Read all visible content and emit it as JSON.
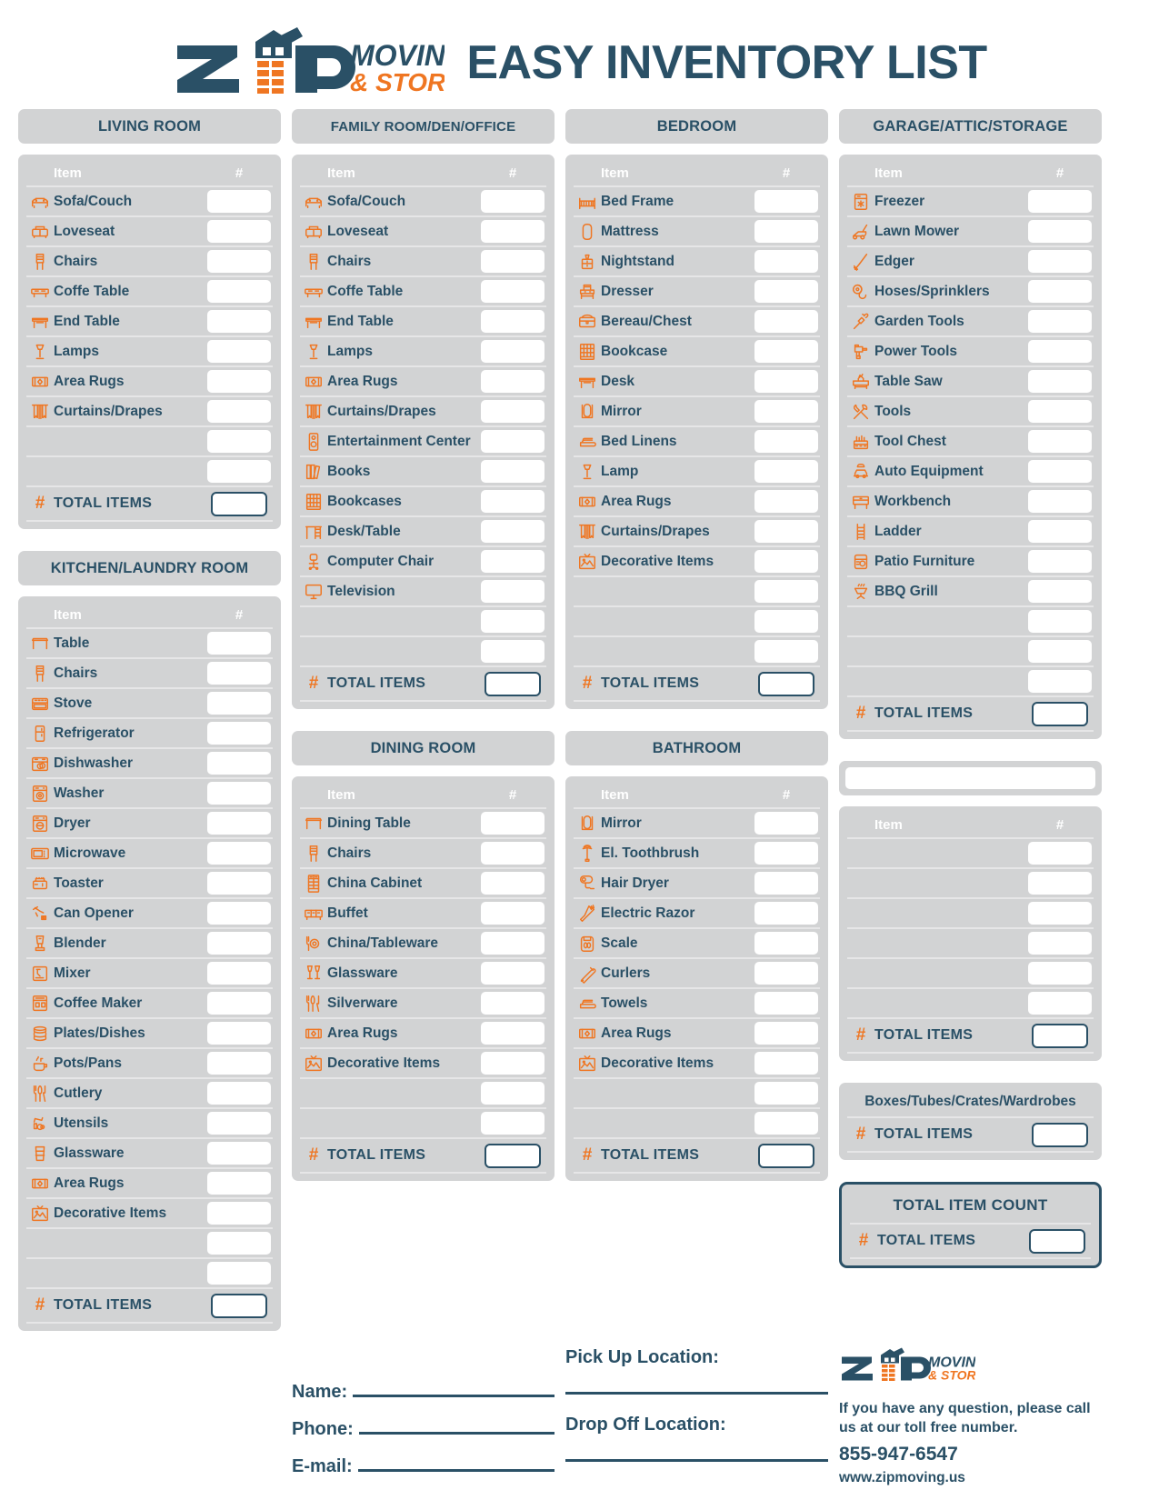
{
  "header": {
    "brand_name": "ZIP MOVING & STORAGE",
    "brand_line1": "MOVING",
    "brand_line2": "& STORAGE",
    "title": "EASY INVENTORY LIST"
  },
  "labels": {
    "item": "Item",
    "num": "#",
    "hash": "#",
    "total_items": "TOTAL ITEMS"
  },
  "colors": {
    "navy": "#2a5066",
    "orange": "#ef7622",
    "panel_gray": "#d2d3d4",
    "divider": "#e6e6e7",
    "white": "#ffffff"
  },
  "sections": [
    {
      "id": "living-room",
      "title": "LIVING ROOM",
      "items": [
        {
          "label": "Sofa/Couch",
          "icon": "sofa-icon"
        },
        {
          "label": "Loveseat",
          "icon": "loveseat-icon"
        },
        {
          "label": "Chairs",
          "icon": "chair-icon"
        },
        {
          "label": "Coffe Table",
          "icon": "coffee-table-icon"
        },
        {
          "label": "End Table",
          "icon": "end-table-icon"
        },
        {
          "label": "Lamps",
          "icon": "lamp-icon"
        },
        {
          "label": "Area Rugs",
          "icon": "rug-icon"
        },
        {
          "label": "Curtains/Drapes",
          "icon": "curtains-icon"
        }
      ],
      "blank_rows": 2
    },
    {
      "id": "kitchen-laundry-room",
      "title": "KITCHEN/LAUNDRY ROOM",
      "items": [
        {
          "label": "Table",
          "icon": "table-icon"
        },
        {
          "label": "Chairs",
          "icon": "chair-icon"
        },
        {
          "label": "Stove",
          "icon": "stove-icon"
        },
        {
          "label": "Refrigerator",
          "icon": "refrigerator-icon"
        },
        {
          "label": "Dishwasher",
          "icon": "dishwasher-icon"
        },
        {
          "label": "Washer",
          "icon": "washer-icon"
        },
        {
          "label": "Dryer",
          "icon": "dryer-icon"
        },
        {
          "label": "Microwave",
          "icon": "microwave-icon"
        },
        {
          "label": "Toaster",
          "icon": "toaster-icon"
        },
        {
          "label": "Can Opener",
          "icon": "can-opener-icon"
        },
        {
          "label": "Blender",
          "icon": "blender-icon"
        },
        {
          "label": "Mixer",
          "icon": "mixer-icon"
        },
        {
          "label": "Coffee Maker",
          "icon": "coffee-maker-icon"
        },
        {
          "label": "Plates/Dishes",
          "icon": "plates-icon"
        },
        {
          "label": "Pots/Pans",
          "icon": "pots-pans-icon"
        },
        {
          "label": "Cutlery",
          "icon": "cutlery-icon"
        },
        {
          "label": "Utensils",
          "icon": "utensils-icon"
        },
        {
          "label": "Glassware",
          "icon": "glassware-stack-icon"
        },
        {
          "label": "Area Rugs",
          "icon": "rug-icon"
        },
        {
          "label": "Decorative Items",
          "icon": "decorative-icon"
        }
      ],
      "blank_rows": 2
    },
    {
      "id": "family-room-den-office",
      "title": "FAMILY ROOM/DEN/OFFICE",
      "items": [
        {
          "label": "Sofa/Couch",
          "icon": "sofa-icon"
        },
        {
          "label": "Loveseat",
          "icon": "loveseat-icon"
        },
        {
          "label": "Chairs",
          "icon": "chair-icon"
        },
        {
          "label": "Coffe Table",
          "icon": "coffee-table-icon"
        },
        {
          "label": "End Table",
          "icon": "end-table-icon"
        },
        {
          "label": "Lamps",
          "icon": "lamp-icon"
        },
        {
          "label": "Area Rugs",
          "icon": "rug-icon"
        },
        {
          "label": "Curtains/Drapes",
          "icon": "curtains-icon"
        },
        {
          "label": "Entertainment Center",
          "icon": "speaker-icon"
        },
        {
          "label": "Books",
          "icon": "books-icon"
        },
        {
          "label": "Bookcases",
          "icon": "bookcase-icon"
        },
        {
          "label": "Desk/Table",
          "icon": "desk-table-icon"
        },
        {
          "label": "Computer Chair",
          "icon": "office-chair-icon"
        },
        {
          "label": "Television",
          "icon": "television-icon"
        }
      ],
      "blank_rows": 2
    },
    {
      "id": "dining-room",
      "title": "DINING ROOM",
      "items": [
        {
          "label": "Dining Table",
          "icon": "table-icon"
        },
        {
          "label": "Chairs",
          "icon": "chair-icon"
        },
        {
          "label": "China Cabinet",
          "icon": "china-cabinet-icon"
        },
        {
          "label": "Buffet",
          "icon": "buffet-icon"
        },
        {
          "label": "China/Tableware",
          "icon": "tableware-icon"
        },
        {
          "label": "Glassware",
          "icon": "wine-glasses-icon"
        },
        {
          "label": "Silverware",
          "icon": "silverware-icon"
        },
        {
          "label": "Area Rugs",
          "icon": "rug-icon"
        },
        {
          "label": "Decorative Items",
          "icon": "decorative-icon"
        }
      ],
      "blank_rows": 2
    },
    {
      "id": "bedroom",
      "title": "BEDROOM",
      "items": [
        {
          "label": "Bed Frame",
          "icon": "bed-frame-icon"
        },
        {
          "label": "Mattress",
          "icon": "mattress-icon"
        },
        {
          "label": "Nightstand",
          "icon": "nightstand-icon"
        },
        {
          "label": "Dresser",
          "icon": "dresser-icon"
        },
        {
          "label": "Bereau/Chest",
          "icon": "chest-icon"
        },
        {
          "label": "Bookcase",
          "icon": "bookcase-icon"
        },
        {
          "label": "Desk",
          "icon": "end-table-icon"
        },
        {
          "label": "Mirror",
          "icon": "mirror-icon"
        },
        {
          "label": "Bed Linens",
          "icon": "linens-icon"
        },
        {
          "label": "Lamp",
          "icon": "lamp-icon"
        },
        {
          "label": "Area Rugs",
          "icon": "rug-icon"
        },
        {
          "label": "Curtains/Drapes",
          "icon": "curtains-icon"
        },
        {
          "label": "Decorative Items",
          "icon": "decorative-icon"
        }
      ],
      "blank_rows": 3
    },
    {
      "id": "bathroom",
      "title": "BATHROOM",
      "items": [
        {
          "label": "Mirror",
          "icon": "mirror-icon"
        },
        {
          "label": "El. Toothbrush",
          "icon": "toothbrush-icon"
        },
        {
          "label": "Hair Dryer",
          "icon": "hair-dryer-icon"
        },
        {
          "label": "Electric Razor",
          "icon": "razor-icon"
        },
        {
          "label": "Scale",
          "icon": "scale-icon"
        },
        {
          "label": "Curlers",
          "icon": "curler-icon"
        },
        {
          "label": "Towels",
          "icon": "towels-icon"
        },
        {
          "label": "Area Rugs",
          "icon": "rug-icon"
        },
        {
          "label": "Decorative Items",
          "icon": "decorative-icon"
        }
      ],
      "blank_rows": 2
    },
    {
      "id": "garage-attic-storage",
      "title": "GARAGE/ATTIC/STORAGE",
      "items": [
        {
          "label": "Freezer",
          "icon": "freezer-icon"
        },
        {
          "label": "Lawn Mower",
          "icon": "lawn-mower-icon"
        },
        {
          "label": "Edger",
          "icon": "edger-icon"
        },
        {
          "label": "Hoses/Sprinklers",
          "icon": "hose-icon"
        },
        {
          "label": "Garden Tools",
          "icon": "garden-tools-icon"
        },
        {
          "label": "Power Tools",
          "icon": "power-drill-icon"
        },
        {
          "label": "Table Saw",
          "icon": "table-saw-icon"
        },
        {
          "label": "Tools",
          "icon": "tools-icon"
        },
        {
          "label": "Tool Chest",
          "icon": "tool-chest-icon"
        },
        {
          "label": "Auto Equipment",
          "icon": "auto-equipment-icon"
        },
        {
          "label": "Workbench",
          "icon": "workbench-icon"
        },
        {
          "label": "Ladder",
          "icon": "ladder-icon"
        },
        {
          "label": "Patio Furniture",
          "icon": "patio-furniture-icon"
        },
        {
          "label": "BBQ Grill",
          "icon": "bbq-grill-icon"
        }
      ],
      "blank_rows": 3
    },
    {
      "id": "custom-blank",
      "title": "",
      "items": [],
      "blank_rows": 6
    }
  ],
  "boxes_section": {
    "title": "Boxes/Tubes/Crates/Wardrobes",
    "total_label": "TOTAL ITEMS"
  },
  "grand_total": {
    "title": "TOTAL ITEM COUNT",
    "total_label": "TOTAL ITEMS"
  },
  "footer": {
    "name_label": "Name:",
    "phone_label": "Phone:",
    "email_label": "E-mail:",
    "pickup_label": "Pick Up Location:",
    "dropoff_label": "Drop Off Location:",
    "contact_line1": "If you have any question, please call",
    "contact_line2": "us at our toll free number.",
    "phone_number": "855-947-6547",
    "website": "www.zipmoving.us"
  }
}
